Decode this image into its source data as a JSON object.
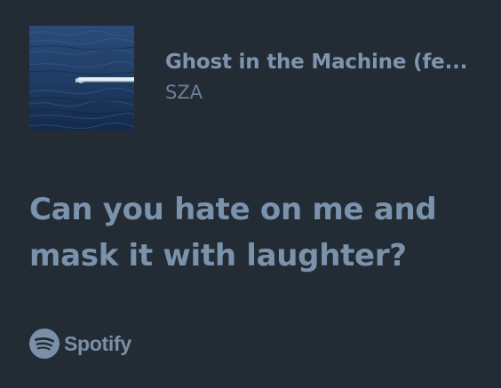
{
  "track": {
    "title": "Ghost in the Machine (fe...",
    "artist": "SZA"
  },
  "lyrics": {
    "lines": [
      "Can you hate on me and",
      "mask it with laughter?"
    ]
  },
  "brand": {
    "name": "Spotify",
    "icon": "spotify-logo-icon"
  },
  "colors": {
    "background": "#232c35",
    "title": "#7f95ad",
    "artist": "#6b8097",
    "lyrics": "#7a92ab",
    "brand": "#7b90a7"
  }
}
